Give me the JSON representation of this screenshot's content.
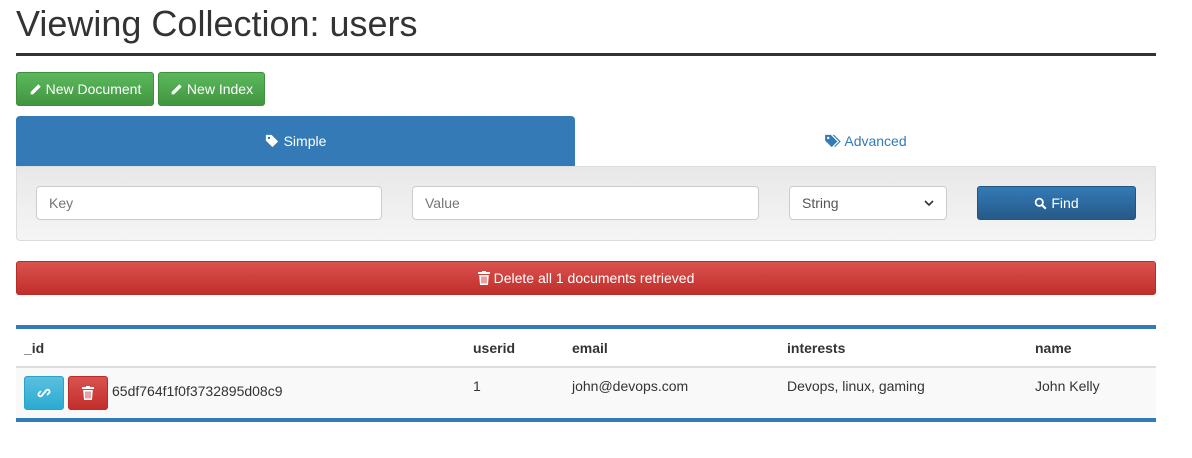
{
  "page": {
    "title": "Viewing Collection: users"
  },
  "toolbar": {
    "new_document_label": "New Document",
    "new_index_label": "New Index"
  },
  "tabs": [
    {
      "label": "Simple",
      "active": true
    },
    {
      "label": "Advanced",
      "active": false
    }
  ],
  "search": {
    "key_placeholder": "Key",
    "value_placeholder": "Value",
    "type_selected": "String",
    "find_label": "Find"
  },
  "delete_all_label": "Delete all 1 documents retrieved",
  "table": {
    "columns": [
      "_id",
      "userid",
      "email",
      "interests",
      "name"
    ],
    "rows": [
      {
        "_id": "65df764f1f0f3732895d08c9",
        "userid": "1",
        "email": "john@devops.com",
        "interests": "Devops, linux, gaming",
        "name": "John Kelly"
      }
    ]
  },
  "icons": [
    "pencil-icon",
    "tag-icon",
    "tags-icon",
    "search-icon",
    "trash-icon",
    "link-icon",
    "chevron-down-icon"
  ],
  "colors": {
    "primary": "#337ab7",
    "success": "#5cb85c",
    "danger": "#d9534f",
    "info": "#5bc0de"
  }
}
